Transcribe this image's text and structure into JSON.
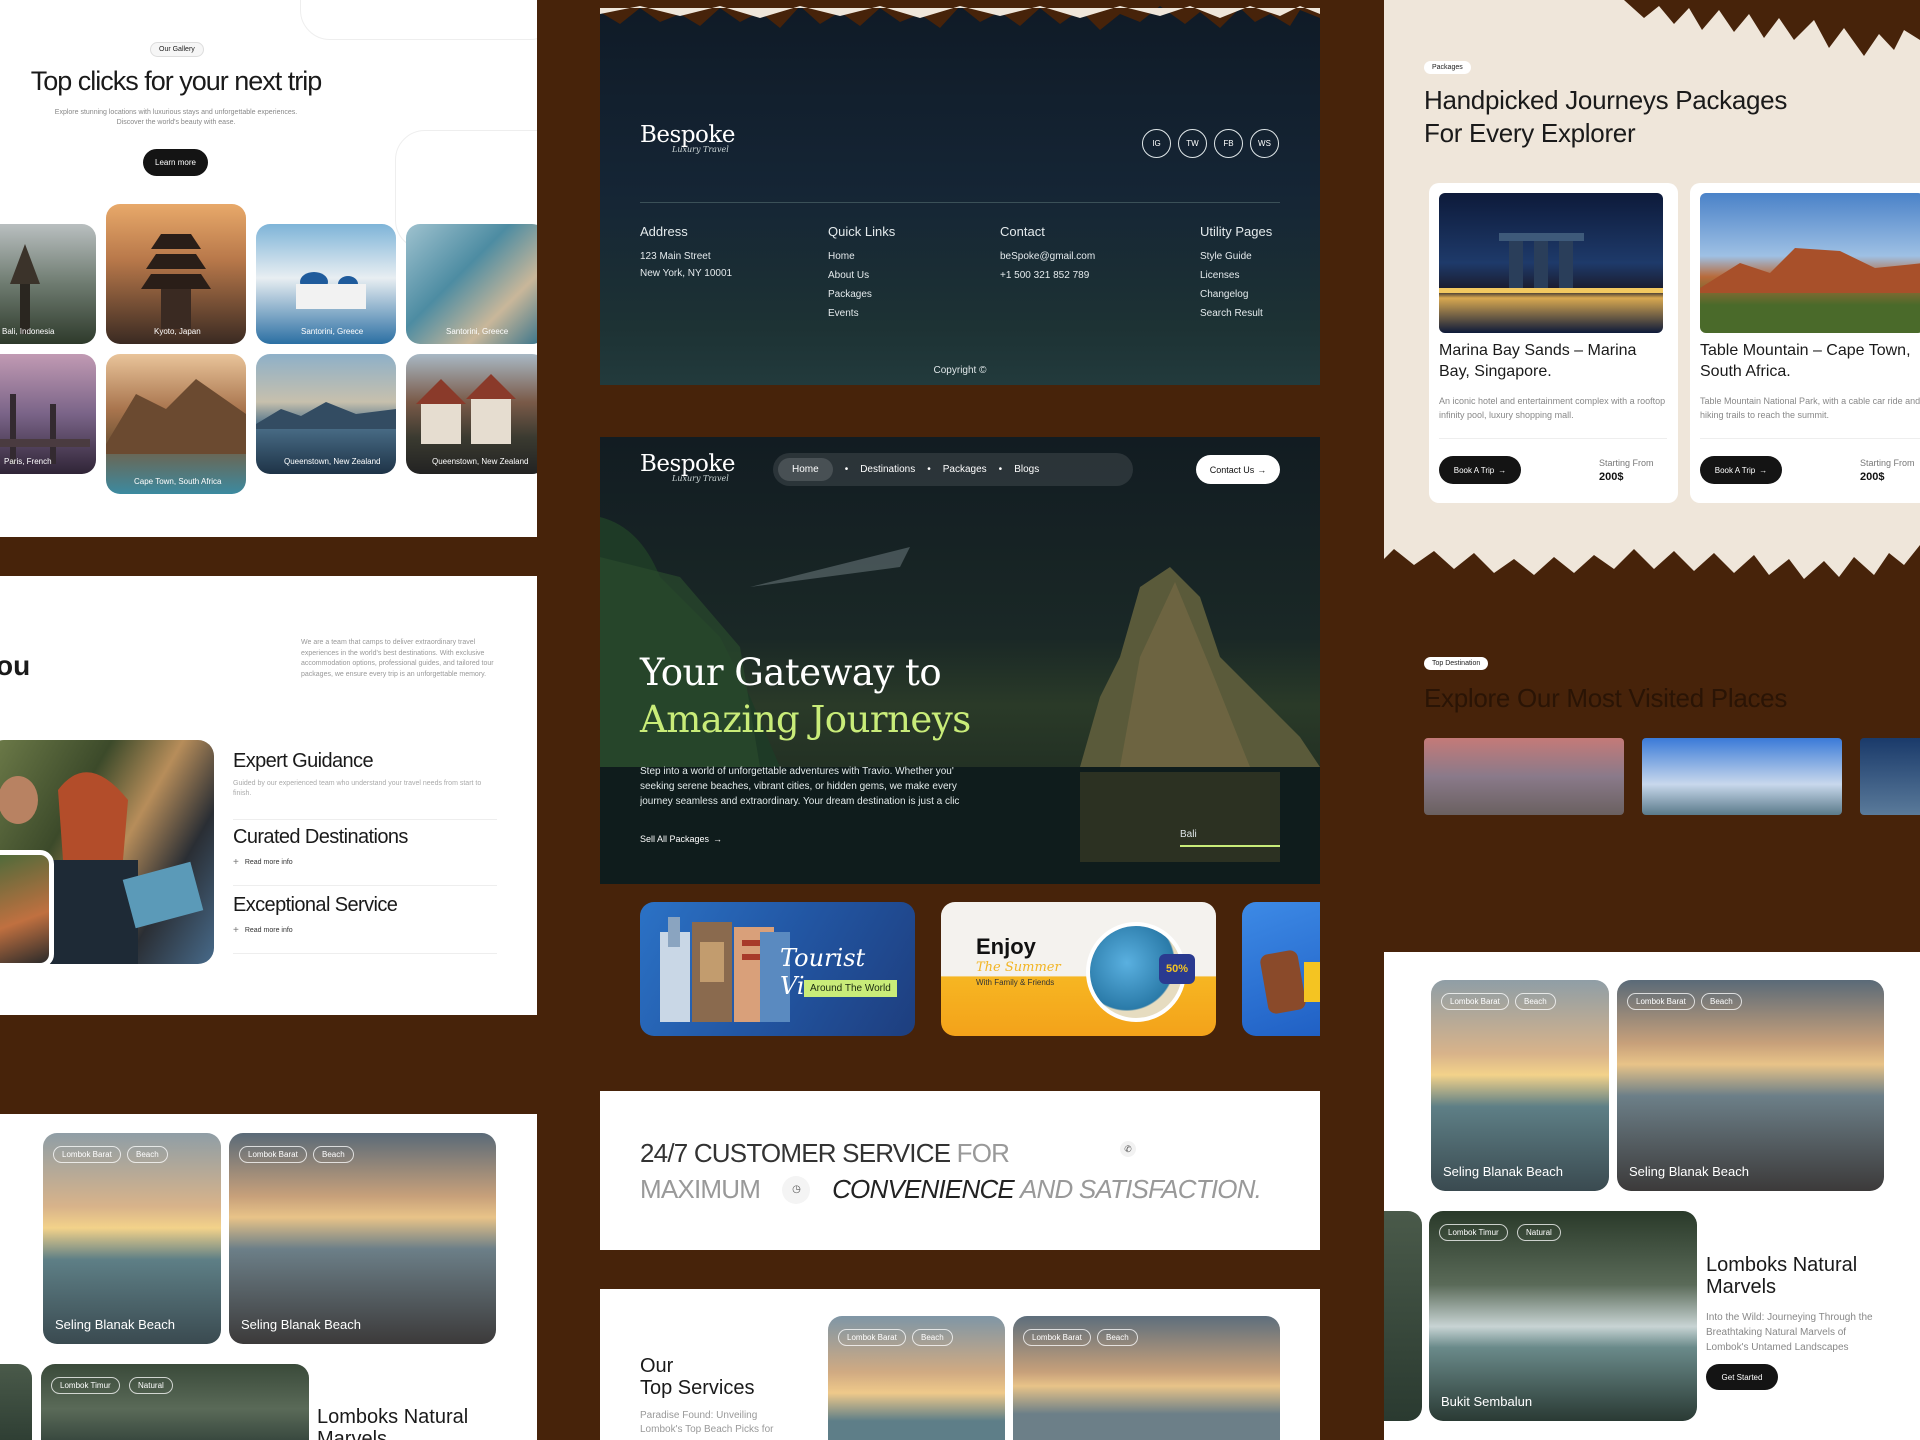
{
  "gallery": {
    "badge": "Our Gallery",
    "title": "Top clicks for your next trip",
    "subtitle": "Explore stunning locations with luxurious stays and unforgettable experiences.\nDiscover the world's beauty with ease.",
    "cta": "Learn more",
    "photos": [
      "Bali, Indonesia",
      "Kyoto, Japan",
      "Santorini, Greece",
      "Santorini, Greece",
      "Paris, French",
      "Cape Town, South Africa",
      "Queenstown, New Zealand",
      "Queenstown, New Zealand"
    ]
  },
  "about": {
    "heading_fragment": "ou",
    "description": "We are a team that camps to deliver extraordinary travel experiences in the world's best destinations. With exclusive accommodation options, professional guides, and tailored tour packages, we ensure every trip is an unforgettable memory.",
    "features": [
      {
        "title": "Expert Guidance",
        "desc": "Guided by our experienced team who understand your travel needs from start to finish."
      },
      {
        "title": "Curated Destinations",
        "link": "Read more info"
      },
      {
        "title": "Exceptional Service",
        "link": "Read more info"
      }
    ]
  },
  "beaches_left": {
    "cards": [
      {
        "tags": [
          "Lombok Barat",
          "Beach"
        ],
        "name": "Seling Blanak Beach"
      },
      {
        "tags": [
          "Lombok Barat",
          "Beach"
        ],
        "name": "Seling Blanak Beach"
      }
    ],
    "natural_tags": [
      "Lombok Timur",
      "Natural"
    ],
    "natural_title": "Lomboks Natural Marvels"
  },
  "footer": {
    "brand": "Bespoke",
    "tagline": "Luxury Travel",
    "socials": [
      "IG",
      "TW",
      "FB",
      "WS"
    ],
    "cols": [
      {
        "title": "Address",
        "items": [
          "123 Main Street",
          "New York, NY 10001"
        ]
      },
      {
        "title": "Quick Links",
        "items": [
          "Home",
          "About Us",
          "Packages",
          "Events"
        ]
      },
      {
        "title": "Contact",
        "items": [
          "beSpoke@gmail.com",
          "+1 500 321 852 789"
        ]
      },
      {
        "title": "Utility Pages",
        "items": [
          "Style Guide",
          "Licenses",
          "Changelog",
          "Search Result"
        ]
      }
    ],
    "copyright": "Copyright ©"
  },
  "hero": {
    "brand": "Bespoke",
    "tagline": "Luxury Travel",
    "nav": [
      "Home",
      "Destinations",
      "Packages",
      "Blogs"
    ],
    "contact_btn": "Contact Us",
    "title_line1": "Your Gateway to",
    "title_line2": "Amazing Journeys",
    "desc": "Step into a world of unforgettable adventures with Travio. Whether you'\nseeking serene beaches, vibrant cities, or hidden gems, we make every\njourney seamless and extraordinary. Your dream destination is just a clic",
    "cta": "Sell All Packages",
    "location": "Bali"
  },
  "promos": {
    "visa_title": "Tourist Visa",
    "visa_sub": "Around The World",
    "enjoy_title": "Enjoy",
    "enjoy_script": "The Summer",
    "enjoy_sub": "With Family & Friends",
    "enjoy_badge": "50%"
  },
  "service": {
    "line1_bold": "24/7 CUSTOMER SERVICE",
    "line1_light": "FOR",
    "line2_light": "MAXIMUM",
    "line2_italic": "CONVENIENCE",
    "line2_end": "AND SATISFACTION."
  },
  "top_services": {
    "title_line1": "Our",
    "title_line2": "Top Services",
    "desc": "Paradise Found: Unveiling\nLombok's Top Beach Picks for",
    "cards": [
      {
        "tags": [
          "Lombok Barat",
          "Beach"
        ]
      },
      {
        "tags": [
          "Lombok Barat",
          "Beach"
        ]
      }
    ]
  },
  "packages": {
    "badge": "Packages",
    "title": "Handpicked Journeys Packages\nFor Every Explorer",
    "cards": [
      {
        "title": "Marina Bay Sands – Marina Bay, Singapore.",
        "desc": "An iconic hotel and entertainment complex with a rooftop infinity pool, luxury shopping mall.",
        "btn": "Book A Trip",
        "price_label": "Starting From",
        "price": "200$"
      },
      {
        "title": "Table Mountain – Cape Town, South Africa.",
        "desc": "Table Mountain National Park, with a cable car ride and hiking trails to reach the summit.",
        "btn": "Book A Trip",
        "price_label": "Starting From",
        "price": "200$"
      }
    ]
  },
  "top_destination": {
    "badge": "Top Destination",
    "title": "Explore Our Most Visited Places"
  },
  "beaches_right": {
    "cards": [
      {
        "tags": [
          "Lombok Barat",
          "Beach"
        ],
        "name": "Seling Blanak Beach"
      },
      {
        "tags": [
          "Lombok Barat",
          "Beach"
        ],
        "name": "Seling Blanak Beach"
      }
    ],
    "natural_tags": [
      "Lombok Timur",
      "Natural"
    ],
    "natural_place": "Bukit Sembalun",
    "natural_title": "Lomboks Natural Marvels",
    "natural_desc": "Into the Wild: Journeying Through the Breathtaking Natural Marvels of Lombok's Untamed Landscapes",
    "natural_btn": "Get Started"
  },
  "colors": {
    "background": "#47230a",
    "accent_green": "#c9ec79",
    "footer_bg": "#13202c"
  }
}
